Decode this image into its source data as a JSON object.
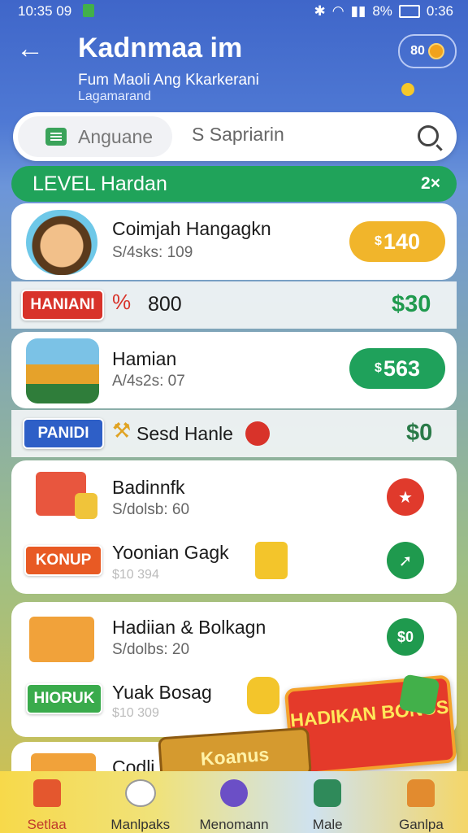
{
  "status_bar": {
    "time_left": "10:35 09",
    "battery": "8%",
    "time_right": "0:36"
  },
  "header": {
    "back_icon": "arrow-left-icon",
    "title": "Kadnmaa im",
    "subtitle": "Fum Maoli Ang Kkarkerani",
    "subtitle2": "Lagamarand",
    "coin_badge": "80"
  },
  "search": {
    "tab_label": "Anguane",
    "placeholder": "S Sapriarin"
  },
  "level_bar": {
    "label": "LEVEL Hardan",
    "multiplier": "2×"
  },
  "rows": [
    {
      "name": "Coimjah Hangagkn",
      "meta": "S/4sks: 109",
      "price": "140"
    },
    {
      "tag": "HANIANI",
      "mid": "800",
      "price": "$30"
    },
    {
      "name": "Hamian",
      "meta": "A/4s2s: 07",
      "price": "563"
    },
    {
      "tag": "PANIDI",
      "mid": "Sesd Hanle",
      "price": "$0"
    },
    {
      "name": "Badinnfk",
      "meta": "S/dolsb: 60"
    },
    {
      "tag": "KONUP",
      "name": "Yoonian Gagk",
      "meta": "$10 394"
    },
    {
      "name": "Hadiian & Bolkagn",
      "meta": "S/dolbs: 20",
      "price": "$0"
    },
    {
      "tag": "HIORUK",
      "name": "Yuak Bosag",
      "meta": "$10 309"
    },
    {
      "name": "Codli"
    }
  ],
  "bonus": {
    "banner": "HADIKAN BONUS",
    "ribbon": "Koanus"
  },
  "nav": [
    {
      "label": "Setlaa",
      "icon": "home-icon",
      "active": true
    },
    {
      "label": "Manlpaks",
      "icon": "users-icon"
    },
    {
      "label": "Menomann",
      "icon": "game-icon"
    },
    {
      "label": "Male",
      "icon": "card-icon"
    },
    {
      "label": "Ganlpa",
      "icon": "home-alt-icon"
    }
  ]
}
